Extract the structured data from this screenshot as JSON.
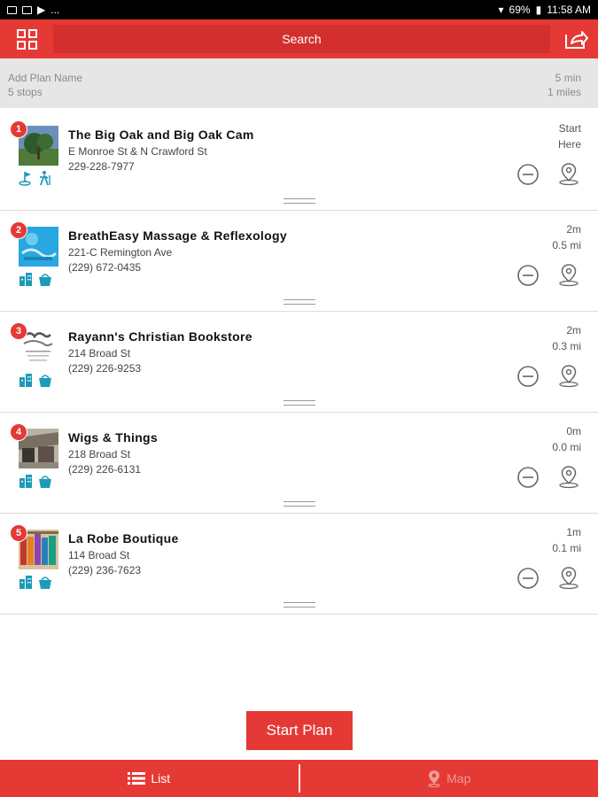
{
  "statusbar": {
    "battery": "69%",
    "time": "11:58 AM",
    "dots": "..."
  },
  "header": {
    "search_placeholder": "Search"
  },
  "plan": {
    "name_placeholder": "Add Plan Name",
    "stops_count": "5 stops",
    "total_time": "5 min",
    "total_distance": "1 miles"
  },
  "stops": [
    {
      "number": "1",
      "name": "The Big Oak and Big Oak Cam",
      "address": "E Monroe St & N Crawford St",
      "phone": "229-228-7977",
      "dist_line1": "Start",
      "dist_line2": "Here",
      "categories": [
        "golf-icon",
        "hiker-icon"
      ]
    },
    {
      "number": "2",
      "name": "BreathEasy Massage & Reflexology",
      "address": "221-C Remington Ave",
      "phone": "(229) 672-0435",
      "dist_line1": "2m",
      "dist_line2": "0.5 mi",
      "categories": [
        "buildings-icon",
        "shopping-basket-icon"
      ]
    },
    {
      "number": "3",
      "name": "Rayann's Christian Bookstore",
      "address": "214 Broad St",
      "phone": "(229) 226-9253",
      "dist_line1": "2m",
      "dist_line2": "0.3 mi",
      "categories": [
        "buildings-icon",
        "shopping-basket-icon"
      ]
    },
    {
      "number": "4",
      "name": "Wigs & Things",
      "address": "218 Broad St",
      "phone": "(229) 226-6131",
      "dist_line1": "0m",
      "dist_line2": "0.0 mi",
      "categories": [
        "buildings-icon",
        "shopping-basket-icon"
      ]
    },
    {
      "number": "5",
      "name": "La Robe Boutique",
      "address": "114 Broad St",
      "phone": "(229) 236-7623",
      "dist_line1": "1m",
      "dist_line2": "0.1 mi",
      "categories": [
        "buildings-icon",
        "shopping-basket-icon"
      ]
    }
  ],
  "actions": {
    "start_plan": "Start Plan"
  },
  "bottom_nav": {
    "list_label": "List",
    "map_label": "Map"
  },
  "colors": {
    "brand_red": "#e53935",
    "category_teal": "#1e9bb8"
  }
}
